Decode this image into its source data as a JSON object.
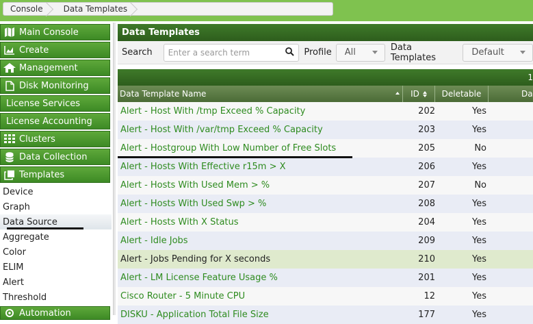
{
  "breadcrumb": [
    "Console",
    "Data Templates"
  ],
  "sidebar": {
    "main_items": [
      {
        "label": "Main Console",
        "icon": "map-icon"
      },
      {
        "label": "Create",
        "icon": "chart-icon"
      },
      {
        "label": "Management",
        "icon": "home-icon"
      },
      {
        "label": "Disk Monitoring",
        "icon": "document-icon"
      },
      {
        "label": "License Services",
        "icon": ""
      },
      {
        "label": "License Accounting",
        "icon": ""
      },
      {
        "label": "Clusters",
        "icon": "grid-icon"
      },
      {
        "label": "Data Collection",
        "icon": "database-icon"
      },
      {
        "label": "Templates",
        "icon": "copy-icon"
      }
    ],
    "sub_items": [
      "Device",
      "Graph",
      "Data Source",
      "Aggregate",
      "Color",
      "ELIM",
      "Alert",
      "Threshold"
    ],
    "active_sub": "Data Source",
    "bottom_item": "Automation"
  },
  "panel": {
    "title": "Data Templates",
    "search_label": "Search",
    "search_placeholder": "Enter a search term",
    "profile_label": "Profile",
    "profile_value": "All",
    "templates_label": "Data Templates",
    "templates_value": "Default",
    "pager_text": "1"
  },
  "table": {
    "columns": [
      "Data Template Name",
      "ID",
      "Deletable",
      "Da"
    ],
    "rows": [
      {
        "name": "Alert - Host With /tmp Exceed % Capacity",
        "id": "202",
        "deletable": "Yes"
      },
      {
        "name": "Alert - Host With /var/tmp Exceed % Capacity",
        "id": "203",
        "deletable": "Yes"
      },
      {
        "name": "Alert - Hostgroup With Low Number of Free Slots",
        "id": "205",
        "deletable": "No"
      },
      {
        "name": "Alert - Hosts With Effective r15m > X",
        "id": "206",
        "deletable": "Yes"
      },
      {
        "name": "Alert - Hosts With Used Mem > %",
        "id": "207",
        "deletable": "No"
      },
      {
        "name": "Alert - Hosts With Used Swp > %",
        "id": "208",
        "deletable": "Yes"
      },
      {
        "name": "Alert - Hosts With X Status",
        "id": "204",
        "deletable": "Yes"
      },
      {
        "name": "Alert - Idle Jobs",
        "id": "209",
        "deletable": "Yes"
      },
      {
        "name": "Alert - Jobs Pending for X seconds",
        "id": "210",
        "deletable": "Yes"
      },
      {
        "name": "Alert - LM License Feature Usage %",
        "id": "201",
        "deletable": "Yes"
      },
      {
        "name": "Cisco Router - 5 Minute CPU",
        "id": "12",
        "deletable": "Yes"
      },
      {
        "name": "DISKU - Application Total File Size",
        "id": "177",
        "deletable": "Yes"
      }
    ]
  },
  "colors": {
    "accent_green": "#3d8a25",
    "topbar": "#7fc24f",
    "link": "#2e8b1f"
  }
}
